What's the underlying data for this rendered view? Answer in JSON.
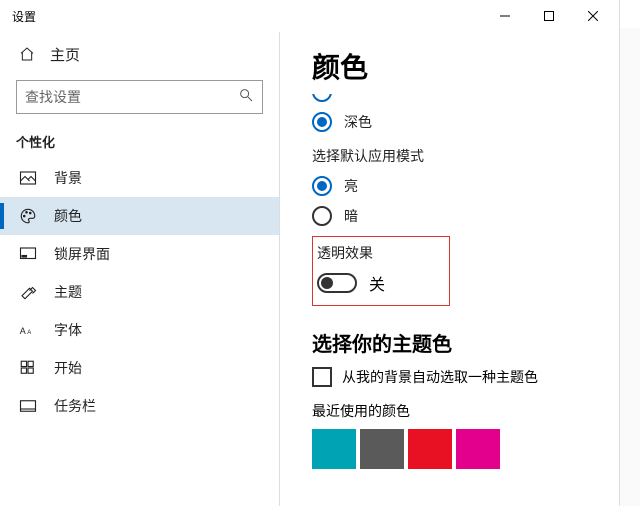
{
  "window": {
    "title": "设置"
  },
  "controls": {
    "min": "min",
    "max": "max",
    "close": "close"
  },
  "home": {
    "label": "主页"
  },
  "search": {
    "placeholder": "查找设置"
  },
  "category": {
    "label": "个性化"
  },
  "nav": {
    "items": [
      {
        "label": "背景"
      },
      {
        "label": "颜色"
      },
      {
        "label": "锁屏界面"
      },
      {
        "label": "主题"
      },
      {
        "label": "字体"
      },
      {
        "label": "开始"
      },
      {
        "label": "任务栏"
      }
    ]
  },
  "page": {
    "title": "颜色",
    "windows_mode": {
      "dark": "深色"
    },
    "app_mode": {
      "heading": "选择默认应用模式",
      "light": "亮",
      "dark": "暗"
    },
    "transparency": {
      "heading": "透明效果",
      "state": "关"
    },
    "accent": {
      "heading": "选择你的主题色",
      "auto_label": "从我的背景自动选取一种主题色",
      "recent_heading": "最近使用的颜色",
      "recent_colors": [
        "#00a3b4",
        "#5a5a5a",
        "#e81123",
        "#e3008c"
      ]
    }
  }
}
